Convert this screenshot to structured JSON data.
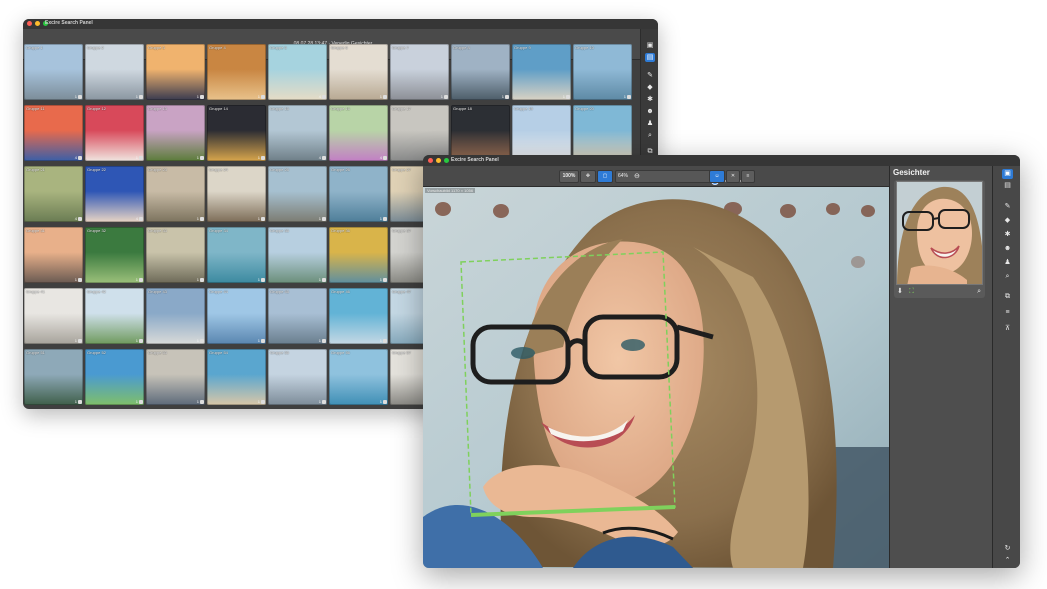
{
  "window1": {
    "title": "Excire Search Panel",
    "toolbar_text": "08.07.28 13:47 · Venedig Gesichter",
    "groups": [
      {
        "label": "Gruppe 1",
        "count": "1"
      },
      {
        "label": "Gruppe 2",
        "count": "1"
      },
      {
        "label": "Gruppe 3",
        "count": "1"
      },
      {
        "label": "Gruppe 4",
        "count": "1"
      },
      {
        "label": "Gruppe 5",
        "count": "4"
      },
      {
        "label": "Gruppe 6",
        "count": "1"
      },
      {
        "label": "Gruppe 7",
        "count": "1"
      },
      {
        "label": "Gruppe 8",
        "count": "1"
      },
      {
        "label": "Gruppe 9",
        "count": "1"
      },
      {
        "label": "Gruppe 10",
        "count": "1"
      },
      {
        "label": "Gruppe 11",
        "count": "4"
      },
      {
        "label": "Gruppe 12",
        "count": "1"
      },
      {
        "label": "Gruppe 13",
        "count": "1"
      },
      {
        "label": "Gruppe 14",
        "count": "1"
      },
      {
        "label": "Gruppe 15",
        "count": "4"
      },
      {
        "label": "Gruppe 16",
        "count": "4"
      },
      {
        "label": "Gruppe 17",
        "count": "1"
      },
      {
        "label": "Gruppe 18",
        "count": "1"
      },
      {
        "label": "Gruppe 19",
        "count": "1"
      },
      {
        "label": "Gruppe 20",
        "count": "1"
      },
      {
        "label": "Gruppe 21",
        "count": "4"
      },
      {
        "label": "Gruppe 22",
        "count": "4"
      },
      {
        "label": "Gruppe 23",
        "count": "1"
      },
      {
        "label": "Gruppe 24",
        "count": "1"
      },
      {
        "label": "Gruppe 25",
        "count": "1"
      },
      {
        "label": "Gruppe 26",
        "count": "1"
      },
      {
        "label": "Gruppe 27",
        "count": "4"
      },
      {
        "label": "Gruppe 31",
        "count": "1"
      },
      {
        "label": "Gruppe 32",
        "count": "1"
      },
      {
        "label": "Gruppe 33",
        "count": "1"
      },
      {
        "label": "Gruppe 34",
        "count": "1"
      },
      {
        "label": "Gruppe 35",
        "count": "1"
      },
      {
        "label": "Gruppe 36",
        "count": "1"
      },
      {
        "label": "Gruppe 37",
        "count": "1"
      },
      {
        "label": "Gruppe 41",
        "count": "1"
      },
      {
        "label": "Gruppe 42",
        "count": "1"
      },
      {
        "label": "Gruppe 43",
        "count": "1"
      },
      {
        "label": "Gruppe 44",
        "count": "1"
      },
      {
        "label": "Gruppe 45",
        "count": "1"
      },
      {
        "label": "Gruppe 46",
        "count": "1"
      },
      {
        "label": "Gruppe 47",
        "count": "1"
      },
      {
        "label": "Gruppe 51",
        "count": "1"
      },
      {
        "label": "Gruppe 52",
        "count": "1"
      },
      {
        "label": "Gruppe 53",
        "count": "1"
      },
      {
        "label": "Gruppe 54",
        "count": "1"
      },
      {
        "label": "Gruppe 55",
        "count": "1"
      },
      {
        "label": "Gruppe 56",
        "count": "1"
      },
      {
        "label": "Gruppe 57",
        "count": "1"
      }
    ]
  },
  "window2": {
    "title": "Excire Search Panel",
    "toolbar": {
      "zoom_label": "100%",
      "fit_icon": "fit-icon",
      "fill_icon": "fill-icon",
      "percent_label": "64%",
      "zoom_out_icon": "zoom-out-icon",
      "zoom_in_icon": "zoom-in-icon",
      "zoom_level": 0.15,
      "face_icon": "face-icon",
      "compare_icon": "compare-icon",
      "menu_icon": "menu-icon"
    },
    "image_caption": "Vorschaubild 1170 × 1056",
    "side_panel": {
      "title": "Gesichter"
    }
  },
  "colors": {
    "accent": "#2e7bd6",
    "face_box": "#7fd15c",
    "window_bg": "#4c4c4c"
  }
}
